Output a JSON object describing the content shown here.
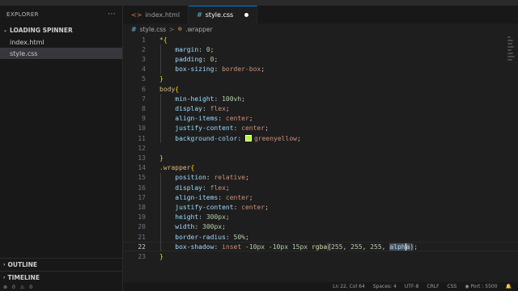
{
  "sidebar": {
    "title": "EXPLORER",
    "menu_icon": "ellipsis-icon",
    "folder": "LOADING SPINNER",
    "files": [
      {
        "name": "index.html",
        "active": false
      },
      {
        "name": "style.css",
        "active": true
      }
    ],
    "sections": [
      "OUTLINE",
      "TIMELINE"
    ],
    "status": {
      "errors": "0",
      "warnings": "0"
    }
  },
  "tabs": [
    {
      "label": "index.html",
      "icon": "html-file-icon",
      "active": false
    },
    {
      "label": "style.css",
      "icon": "css-file-icon",
      "active": true,
      "dirty": true
    }
  ],
  "breadcrumb": {
    "file": "style.css",
    "separator": ">",
    "symbol": ".wrapper"
  },
  "editor": {
    "current_line": 22,
    "lines": [
      {
        "n": "1",
        "t": "*{"
      },
      {
        "n": "2",
        "p": "margin",
        "v": "0"
      },
      {
        "n": "3",
        "p": "padding",
        "v": "0"
      },
      {
        "n": "4",
        "p": "box-sizing",
        "v": "border-box"
      },
      {
        "n": "5",
        "t": "}"
      },
      {
        "n": "6",
        "t": "body{"
      },
      {
        "n": "7",
        "p": "min-height",
        "v": "100vh"
      },
      {
        "n": "8",
        "p": "display",
        "v": "flex"
      },
      {
        "n": "9",
        "p": "align-items",
        "v": "center"
      },
      {
        "n": "10",
        "p": "justify-content",
        "v": "center"
      },
      {
        "n": "11",
        "p": "background-color",
        "v": "greenyellow",
        "swatch": "#adff2f"
      },
      {
        "n": "12",
        "t": ""
      },
      {
        "n": "13",
        "t": "}"
      },
      {
        "n": "14",
        "t": ".wrapper{"
      },
      {
        "n": "15",
        "p": "position",
        "v": "relative"
      },
      {
        "n": "16",
        "p": "display",
        "v": "flex"
      },
      {
        "n": "17",
        "p": "align-items",
        "v": "center"
      },
      {
        "n": "18",
        "p": "justify-content",
        "v": "center"
      },
      {
        "n": "19",
        "p": "height",
        "v": "300px"
      },
      {
        "n": "20",
        "p": "width",
        "v": "300px"
      },
      {
        "n": "21",
        "p": "border-radius",
        "v": "50%"
      },
      {
        "n": "22",
        "p": "box-shadow",
        "v": "inset -10px -10px 15px rgba(255, 255, 255, alpha);"
      },
      {
        "n": "23",
        "t": "}"
      }
    ]
  },
  "statusbar": {
    "position": "Ln 22, Col 64",
    "spaces": "Spaces: 4",
    "encoding": "UTF-8",
    "eol": "CRLF",
    "language": "CSS",
    "port": "Port : 5500"
  },
  "colors": {
    "background": "#1e1e1e",
    "property": "#9cdcfe",
    "value": "#ce9178",
    "number": "#b5cea8",
    "selector": "#d7ba7d",
    "accent": "#0078d4"
  }
}
